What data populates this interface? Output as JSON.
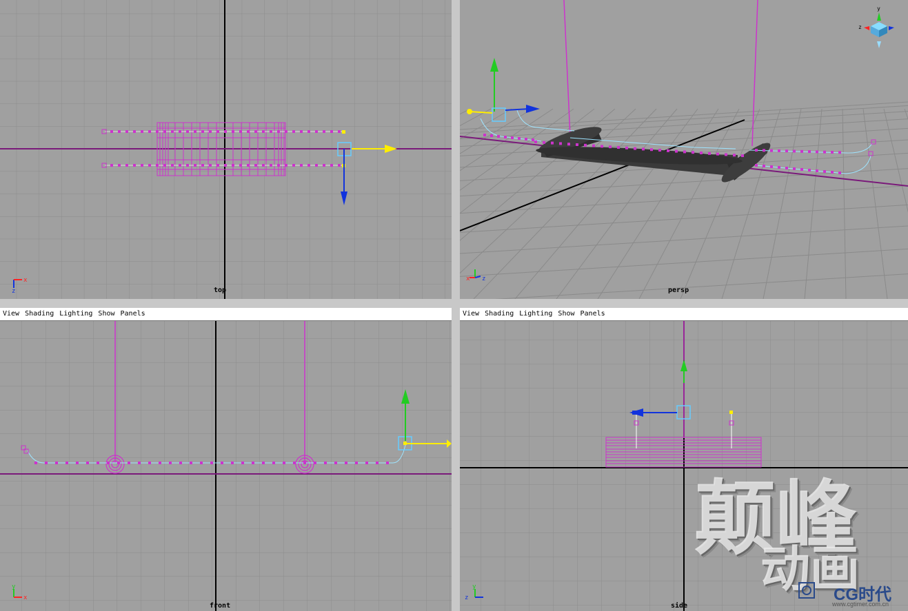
{
  "viewports": {
    "top": {
      "camera": "top"
    },
    "persp": {
      "camera": "persp"
    },
    "front": {
      "camera": "front"
    },
    "side": {
      "camera": "side"
    }
  },
  "panel_menu": [
    "View",
    "Shading",
    "Lighting",
    "Show",
    "Panels"
  ],
  "axis_labels": {
    "x": "x",
    "y": "y",
    "z": "z"
  },
  "watermark": {
    "main": "颠峰",
    "sub": "动画",
    "brand": "CG时代",
    "url": "www.cgtimer.com.cn"
  },
  "colors": {
    "grid_bg": "#a0a0a0",
    "grid_line": "#8a8a8a",
    "origin_line": "#000000",
    "curve": "#cc33cc",
    "curve_light": "#9ee4ff",
    "manip_y": "#22cc22",
    "manip_x": "#ffee00",
    "manip_z": "#1133dd",
    "tube": "#3a3a3a"
  }
}
